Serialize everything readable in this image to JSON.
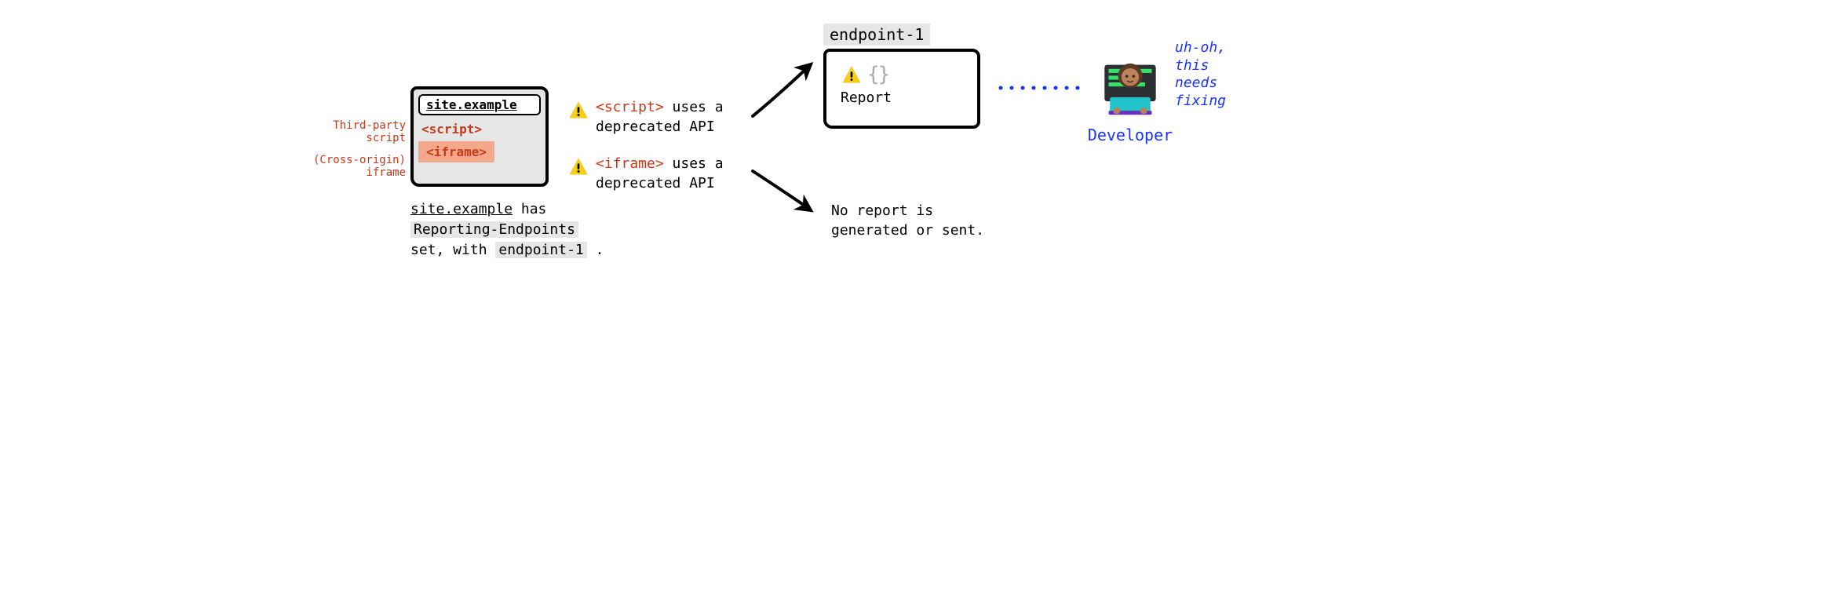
{
  "browser": {
    "url": "site.example",
    "script_tag": "<script>",
    "iframe_tag": "<iframe>"
  },
  "annotations": {
    "third_party_script_l1": "Third-party",
    "third_party_script_l2": "script",
    "cross_origin_iframe_l1": "(Cross-origin)",
    "cross_origin_iframe_l2": "iframe"
  },
  "caption": {
    "p1_prefix": "site.example",
    "p1_rest": " has ",
    "p2_hl": "Reporting-Endpoints",
    "p3_a": "set, with ",
    "p3_hl": "endpoint-1",
    "p3_b": " ."
  },
  "messages": {
    "script_tag": "<script>",
    "script_rest": " uses a deprecated API",
    "iframe_tag": "<iframe>",
    "iframe_rest": " uses a deprecated API"
  },
  "endpoint": {
    "label": "endpoint-1",
    "braces": "{}",
    "report_text": "Report"
  },
  "no_report": {
    "l1": "No report is",
    "l2": "generated or sent."
  },
  "developer": {
    "thought_l1": "uh-oh,",
    "thought_l2": "this",
    "thought_l3": "needs",
    "thought_l4": "fixing",
    "label": "Developer"
  }
}
